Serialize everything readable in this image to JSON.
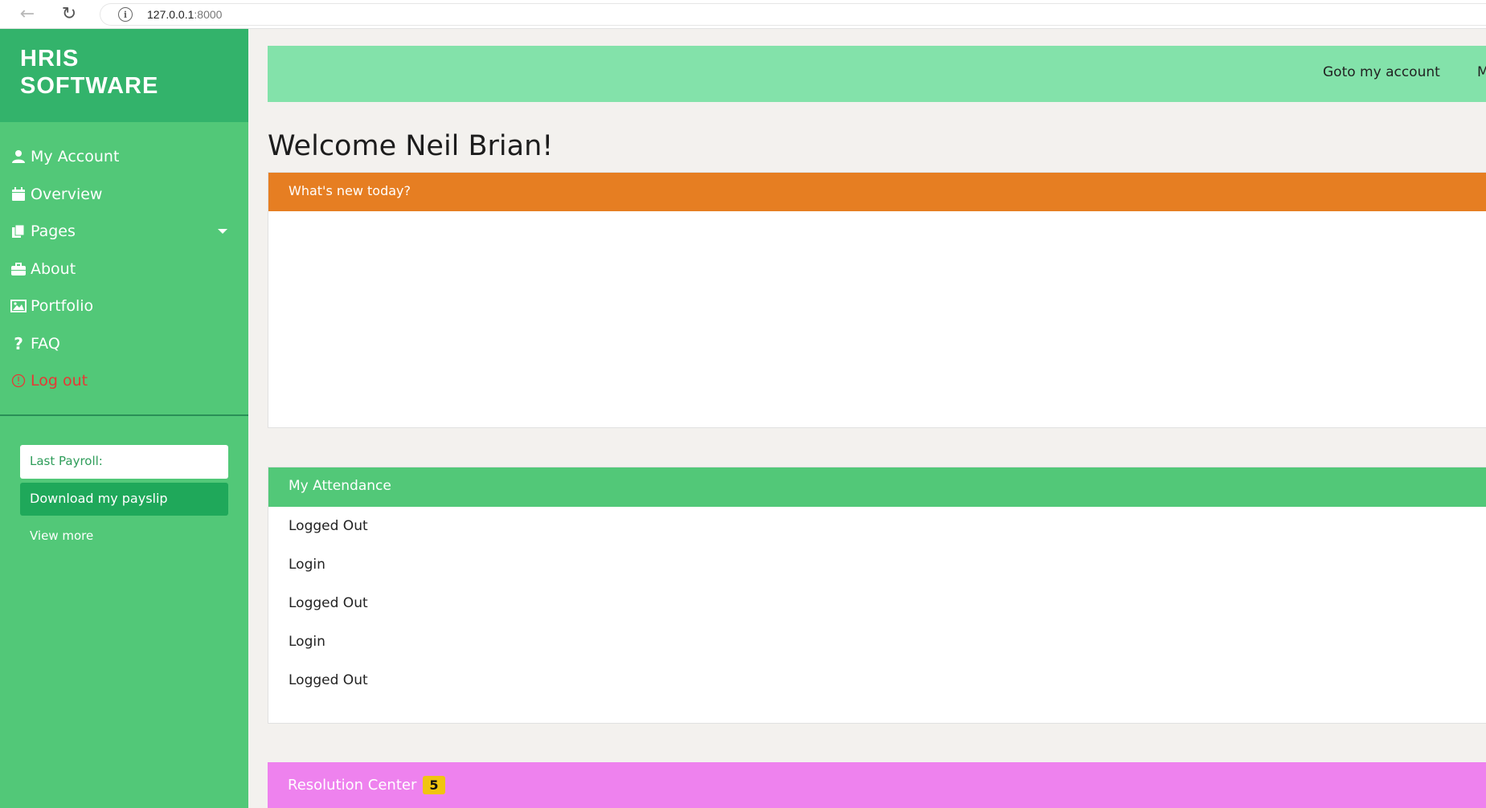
{
  "browser": {
    "back_icon": "←",
    "reload_icon": "↻",
    "info_icon": "i",
    "url_host": "127.0.0.1",
    "url_port": ":8000"
  },
  "sidebar": {
    "brand_line1": "HRIS",
    "brand_line2": "SOFTWARE",
    "items": [
      {
        "label": "My Account",
        "icon": "user-icon"
      },
      {
        "label": "Overview",
        "icon": "calendar-icon"
      },
      {
        "label": "Pages",
        "icon": "copy-icon"
      },
      {
        "label": "About",
        "icon": "briefcase-icon"
      },
      {
        "label": "Portfolio",
        "icon": "image-icon"
      },
      {
        "label": "FAQ",
        "icon": "question-icon"
      },
      {
        "label": "Log out",
        "icon": "power-icon"
      }
    ],
    "last_payroll_label": "Last Payroll:",
    "download_payslip_label": "Download my payslip",
    "view_more_label": "View more"
  },
  "topbar": {
    "goto_account_label": "Goto my account",
    "cut_text": "M"
  },
  "main": {
    "welcome": "Welcome Neil Brian!",
    "news_title": "What's new today?",
    "attendance_title": "My Attendance",
    "attendance": [
      "Logged Out",
      "Login",
      "Logged Out",
      "Login",
      "Logged Out"
    ],
    "resolution_title": "Resolution Center",
    "resolution_count": "5"
  },
  "colors": {
    "sidebar": "#52c878",
    "brand": "#33b36b",
    "topbar": "#83e2aa",
    "news_header": "#e67e22",
    "attendance_header": "#52c878",
    "resolution_header": "#ee82ee",
    "badge": "#f1c40f",
    "logout": "#e53935"
  }
}
